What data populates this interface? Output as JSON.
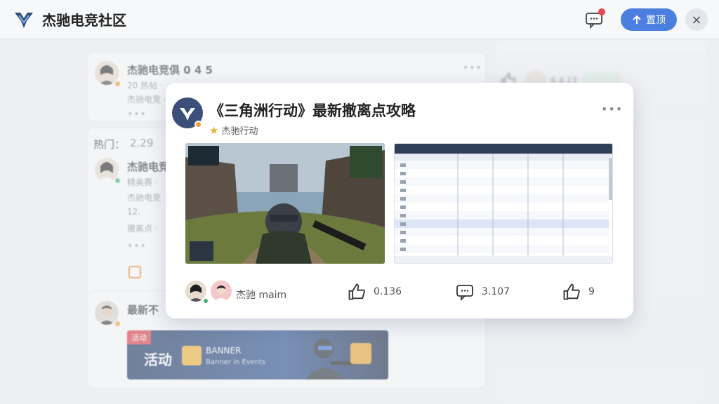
{
  "header": {
    "app_title": "杰驰电竞社区",
    "post_button_label": "置顶",
    "close_glyph": "×",
    "icons": [
      "logo-icon",
      "message-icon",
      "up-arrow-icon",
      "close-icon"
    ]
  },
  "feed": {
    "card1": {
      "title": "杰驰电竞俱 0 4 5",
      "line1": "20 热帖 ·",
      "line2": "杰驰电竞 ·"
    },
    "card2": {
      "section_label": "热门：",
      "section_value": "2.29",
      "title": "杰驰电竞",
      "line1": "精美赛 ·",
      "line2": "杰驰电竞",
      "line3": "12.",
      "line4": "撤离点 ·"
    },
    "card3": {
      "title": "最新不"
    },
    "banner": {
      "badge": "活动",
      "main": "活动",
      "label": "BANNER",
      "sub": "Banner in Events"
    }
  },
  "right_panel": {
    "like_count": "6.4.13"
  },
  "modal": {
    "title": "《三角洲行动》最新撤离点攻略",
    "tag": "杰驰行动",
    "tag_icon": "star-icon",
    "author": "杰驰 maim",
    "likes": "0.136",
    "comments": "3.107",
    "shares": "9",
    "more_glyph": "•••",
    "accent_color": "#4a7fe0"
  }
}
